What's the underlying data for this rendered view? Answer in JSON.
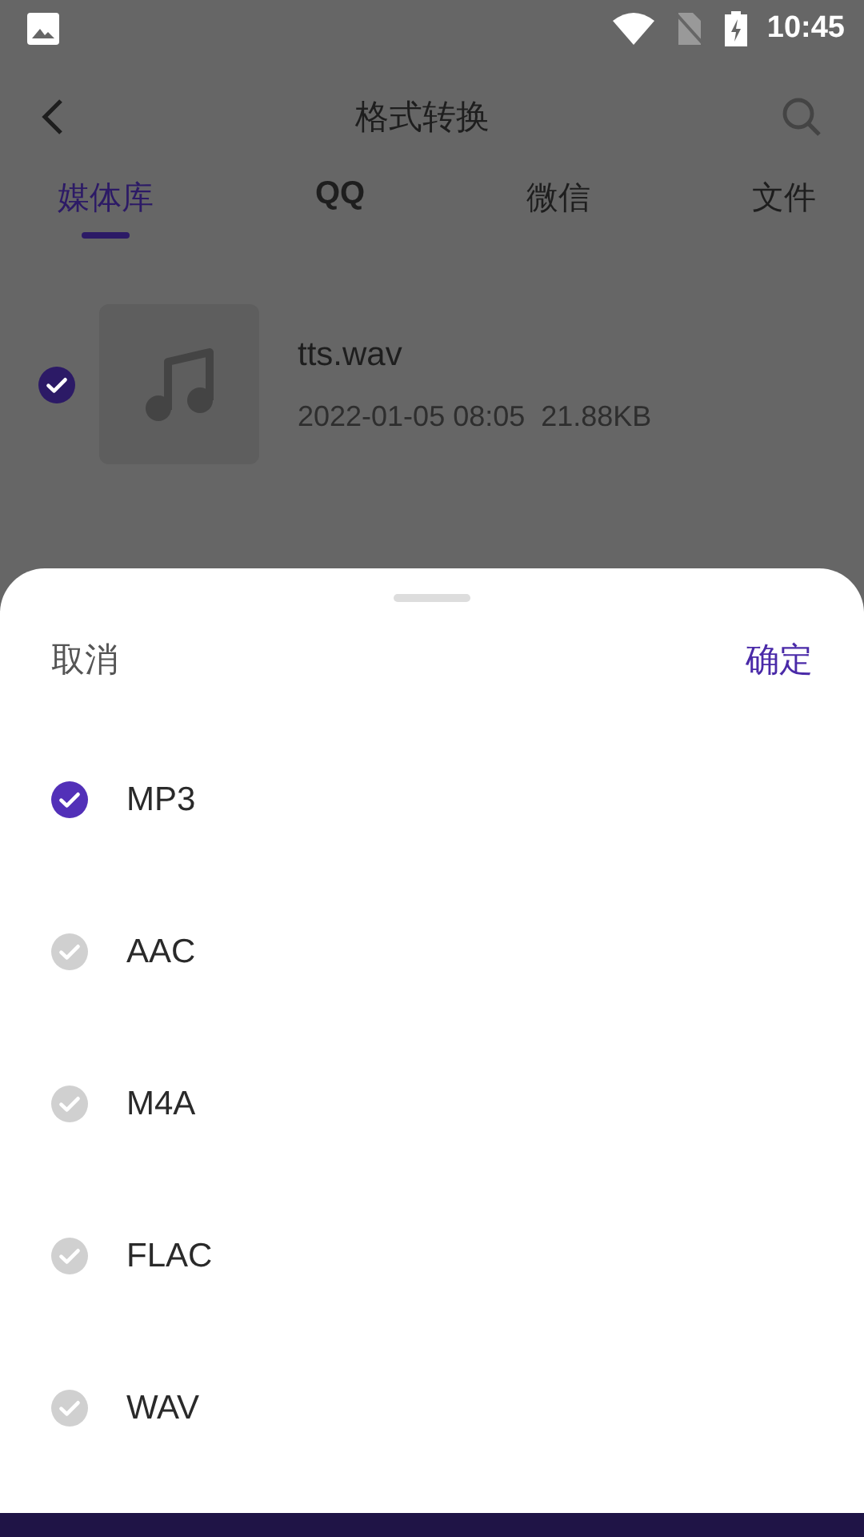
{
  "status_bar": {
    "time": "10:45"
  },
  "header": {
    "title": "格式转换"
  },
  "tabs": [
    {
      "label": "媒体库",
      "selected": true
    },
    {
      "label": "QQ",
      "selected": false
    },
    {
      "label": "微信",
      "selected": false
    },
    {
      "label": "文件",
      "selected": false
    }
  ],
  "files": [
    {
      "name": "tts.wav",
      "date": "2022-01-05 08:05",
      "size": "21.88KB",
      "checked": true
    }
  ],
  "sheet": {
    "cancel": "取消",
    "confirm": "确定",
    "options": [
      {
        "label": "MP3",
        "selected": true
      },
      {
        "label": "AAC",
        "selected": false
      },
      {
        "label": "M4A",
        "selected": false
      },
      {
        "label": "FLAC",
        "selected": false
      },
      {
        "label": "WAV",
        "selected": false
      }
    ]
  }
}
